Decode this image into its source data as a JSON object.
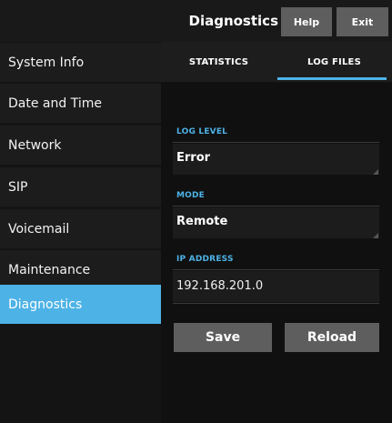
{
  "header": {
    "title": "Diagnostics",
    "help_label": "Help",
    "exit_label": "Exit"
  },
  "sidebar": {
    "items": [
      {
        "label": "System Info"
      },
      {
        "label": "Date and Time"
      },
      {
        "label": "Network"
      },
      {
        "label": "SIP"
      },
      {
        "label": "Voicemail"
      },
      {
        "label": "Maintenance"
      },
      {
        "label": "Diagnostics",
        "active": true
      }
    ]
  },
  "tabs": [
    {
      "label": "STATISTICS"
    },
    {
      "label": "LOG FILES",
      "active": true
    }
  ],
  "form": {
    "log_level": {
      "label": "LOG LEVEL",
      "value": "Error"
    },
    "mode": {
      "label": "MODE",
      "value": "Remote"
    },
    "ip_address": {
      "label": "IP ADDRESS",
      "value": "192.168.201.0"
    }
  },
  "buttons": {
    "save": "Save",
    "reload": "Reload"
  },
  "colors": {
    "accent": "#4db2e6",
    "button_gray": "#5e5e5e"
  }
}
